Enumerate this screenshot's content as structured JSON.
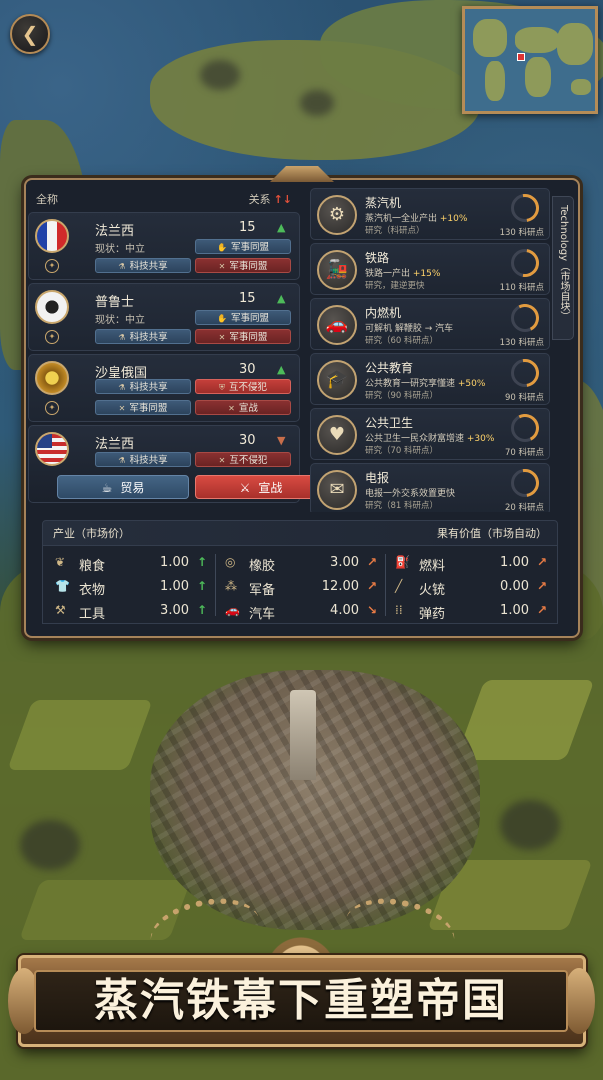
{
  "diplomacy": {
    "header_left": "全称",
    "header_right": "关系",
    "sort_icon": "↑↓",
    "nations": [
      {
        "name": "法兰西",
        "score": "15",
        "trend": "up",
        "flag": "france",
        "status": "现状：中立",
        "actions": [
          {
            "label": "军事同盟",
            "style": "blue",
            "icon": "handshake-icon"
          },
          {
            "label": "科技共享",
            "style": "blue",
            "icon": "flask-icon"
          },
          {
            "label": "军事同盟",
            "style": "red",
            "icon": "crossed-swords-icon"
          }
        ]
      },
      {
        "name": "普鲁士",
        "score": "15",
        "trend": "up",
        "flag": "prussia",
        "status": "现状：中立",
        "actions": [
          {
            "label": "军事同盟",
            "style": "blue",
            "icon": "handshake-icon"
          },
          {
            "label": "科技共享",
            "style": "blue",
            "icon": "flask-icon"
          },
          {
            "label": "军事同盟",
            "style": "red",
            "icon": "crossed-swords-icon"
          }
        ]
      },
      {
        "name": "沙皇俄国",
        "score": "30",
        "trend": "up",
        "flag": "russia",
        "actions": [
          {
            "label": "科技共享",
            "style": "blue",
            "icon": "flask-icon"
          },
          {
            "label": "互不侵犯",
            "style": "brightred",
            "icon": "shield-icon"
          },
          {
            "label": "军事同盟",
            "style": "blue",
            "icon": "crossed-swords-icon"
          },
          {
            "label": "宣战",
            "style": "red",
            "icon": "crossed-swords-icon"
          }
        ]
      },
      {
        "name": "法兰西",
        "score": "30",
        "trend": "down",
        "flag": "usa",
        "actions": [
          {
            "label": "科技共享",
            "style": "blue",
            "icon": "flask-icon"
          },
          {
            "label": "互不侵犯",
            "style": "red",
            "icon": "crossed-swords-icon"
          }
        ]
      }
    ],
    "trade_label": "贸易",
    "war_label": "宣战"
  },
  "technology": {
    "tab_label": "Technology（市场自块）",
    "items": [
      {
        "name": "蒸汽机",
        "icon": "gear-engine-icon",
        "desc": "蒸汽机一全业产出",
        "bonus": "+10%",
        "status": "研究（科研点）",
        "cost": "130 科研点",
        "progress": 0.35
      },
      {
        "name": "铁路",
        "icon": "locomotive-icon",
        "desc": "铁路一产出",
        "bonus": "+15%",
        "status": "研究，建逆更快",
        "cost": "110 科研点",
        "progress": 0.4
      },
      {
        "name": "内燃机",
        "icon": "car-icon",
        "desc": "可解机 解鞭胶 → 汽车",
        "bonus": "",
        "status": "研究（60 科研点）",
        "cost": "130 科研点",
        "progress": 0.3
      },
      {
        "name": "公共教育",
        "icon": "graduation-cap-icon",
        "desc": "公共教育一研究享懂速",
        "bonus": "+50%",
        "status": "研究（90 科研点）",
        "cost": "90 科研点",
        "progress": 0.35
      },
      {
        "name": "公共卫生",
        "icon": "heart-pulse-icon",
        "desc": "公共卫生一民众财富增速",
        "bonus": "+30%",
        "status": "研究（70 科研点）",
        "cost": "70 科研点",
        "progress": 0.3
      },
      {
        "name": "电报",
        "icon": "envelope-icon",
        "desc": "电报一外交系效置更快",
        "bonus": "",
        "status": "研究（81 科研点）",
        "cost": "20 科研点",
        "progress": 0.35
      }
    ]
  },
  "market": {
    "header_left": "产业（市场价）",
    "header_right": "果有价值（市场自动）",
    "columns": [
      [
        {
          "name": "粮食",
          "value": "1.00",
          "trend": "up",
          "icon": "wheat-icon"
        },
        {
          "name": "衣物",
          "value": "1.00",
          "trend": "up",
          "icon": "shirt-icon"
        },
        {
          "name": "工具",
          "value": "3.00",
          "trend": "up",
          "icon": "tools-icon"
        }
      ],
      [
        {
          "name": "橡胶",
          "value": "3.00",
          "trend": "upright",
          "icon": "rubber-icon"
        },
        {
          "name": "军备",
          "value": "12.00",
          "trend": "upright",
          "icon": "ammo-belt-icon"
        },
        {
          "name": "汽车",
          "value": "4.00",
          "trend": "downright",
          "icon": "car-icon"
        }
      ],
      [
        {
          "name": "燃料",
          "value": "1.00",
          "trend": "upright",
          "icon": "fuel-can-icon"
        },
        {
          "name": "火铳",
          "value": "0.00",
          "trend": "upright",
          "icon": "musket-icon"
        },
        {
          "name": "弹药",
          "value": "1.00",
          "trend": "upright",
          "icon": "bullets-icon"
        }
      ]
    ]
  },
  "banner": {
    "slogan": "蒸汽铁幕下重塑帝国"
  },
  "colors": {
    "panel_bg": "#1b212c",
    "gold_border": "#a6835a",
    "up_green": "#4dbb5a",
    "up_orange": "#e87b45",
    "war_red": "#d84b42"
  }
}
